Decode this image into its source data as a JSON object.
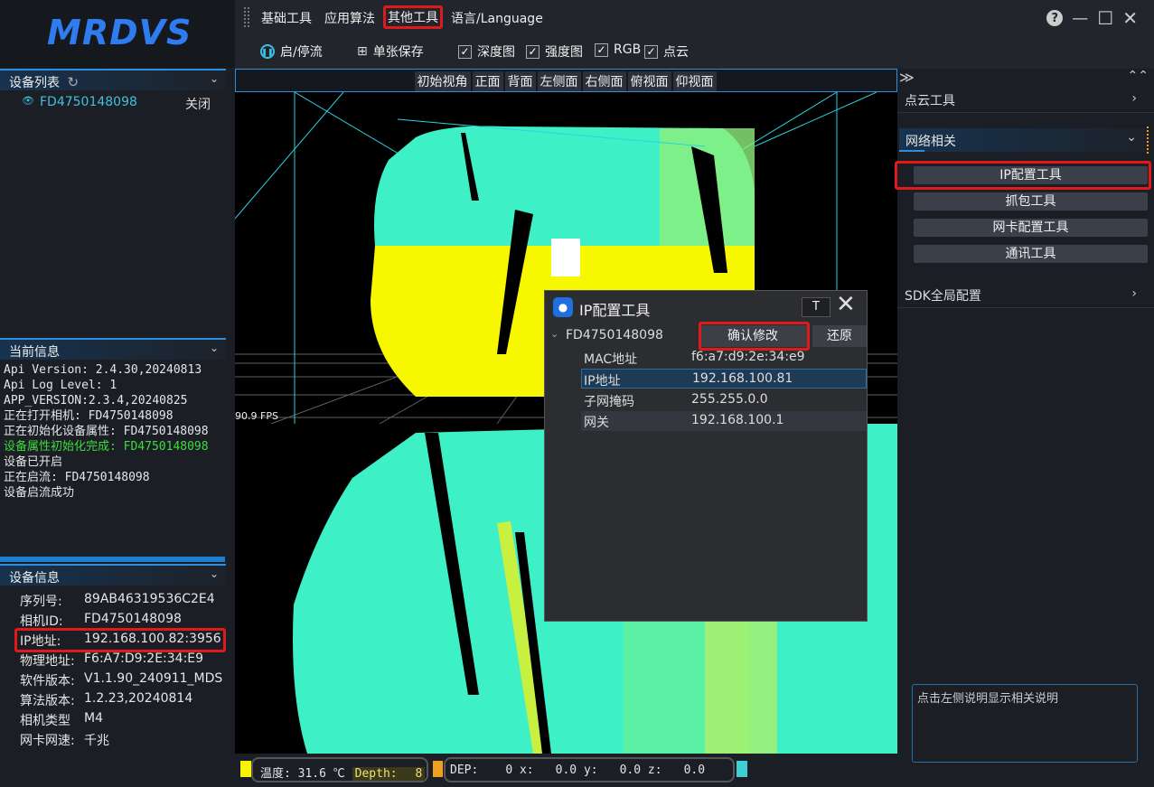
{
  "app": {
    "logo": "MRDVS"
  },
  "menu": {
    "items": [
      "基础工具",
      "应用算法",
      "其他工具",
      "语言/Language"
    ]
  },
  "window_buttons": {
    "help": "?",
    "minimize": "—",
    "maximize": "☐",
    "close": "✕"
  },
  "toolbar": {
    "start_stop": "启/停流",
    "single_save": "单张保存",
    "checks": [
      {
        "label": "深度图",
        "checked": true
      },
      {
        "label": "强度图",
        "checked": true
      },
      {
        "label": "RGB",
        "checked": true
      },
      {
        "label": "点云",
        "checked": true
      }
    ]
  },
  "device_list": {
    "title": "设备列表",
    "devices": [
      {
        "id": "FD4750148098",
        "action": "关闭"
      }
    ]
  },
  "current_info": {
    "title": "当前信息",
    "lines": [
      {
        "text": "Api Version: 2.4.30,20240813",
        "color": "#e6e6e6"
      },
      {
        "text": "Api Log Level: 1",
        "color": "#e6e6e6"
      },
      {
        "text": "APP_VERSION:2.3.4,20240825",
        "color": "#e6e6e6"
      },
      {
        "text": "正在打开相机: FD4750148098",
        "color": "#e6e6e6"
      },
      {
        "text": "正在初始化设备属性: FD4750148098",
        "color": "#e6e6e6"
      },
      {
        "text": "设备属性初始化完成: FD4750148098",
        "color": "#3ddc3d"
      },
      {
        "text": "设备已开启",
        "color": "#e6e6e6"
      },
      {
        "text": "正在启流: FD4750148098",
        "color": "#e6e6e6"
      },
      {
        "text": "设备启流成功",
        "color": "#e6e6e6"
      }
    ]
  },
  "device_info": {
    "title": "设备信息",
    "rows": [
      {
        "label": "序列号:",
        "value": "89AB46319536C2E4"
      },
      {
        "label": "相机ID:",
        "value": "FD4750148098"
      },
      {
        "label": "IP地址:",
        "value": "192.168.100.82:3956"
      },
      {
        "label": "物理地址:",
        "value": "F6:A7:D9:2E:34:E9"
      },
      {
        "label": "软件版本:",
        "value": "V1.1.90_240911_MDS"
      },
      {
        "label": "算法版本:",
        "value": "1.2.23,20240814"
      },
      {
        "label": "相机类型",
        "value": "M4"
      },
      {
        "label": "网卡网速:",
        "value": "千兆"
      }
    ]
  },
  "view_buttons": [
    "初始视角",
    "正面",
    "背面",
    "左侧面",
    "右侧面",
    "俯视面",
    "仰视面"
  ],
  "viewer": {
    "fps": "90.9 FPS"
  },
  "status": {
    "temp_label": "温度:",
    "temp_value": "31.6",
    "temp_unit": "℃",
    "depth_label": "Depth:",
    "depth_value": "8",
    "dep_label": "DEP:",
    "dep_value": "0",
    "x_label": "x:",
    "x_value": "0.0",
    "y_label": "y:",
    "y_value": "0.0",
    "z_label": "z:",
    "z_value": "0.0"
  },
  "right_panel": {
    "pointcloud_tools": "点云工具",
    "network_section": "网络相关",
    "network_tools": [
      "IP配置工具",
      "抓包工具",
      "网卡配置工具",
      "通讯工具"
    ],
    "sdk_config": "SDK全局配置",
    "help_text": "点击左侧说明显示相关说明"
  },
  "ip_dialog": {
    "title": "IP配置工具",
    "pin_label": "T",
    "device": "FD4750148098",
    "confirm": "确认修改",
    "restore": "还原",
    "rows": [
      {
        "label": "MAC地址",
        "value": "f6:a7:d9:2e:34:e9"
      },
      {
        "label": "IP地址",
        "value": "192.168.100.81"
      },
      {
        "label": "子网掩码",
        "value": "255.255.0.0"
      },
      {
        "label": "网关",
        "value": "192.168.100.1"
      }
    ]
  },
  "colors": {
    "accent": "#2d8ee0",
    "highlight": "#e0191b",
    "cloud_cyan": "#3ef0c6",
    "cloud_yellow": "#f7f700"
  }
}
